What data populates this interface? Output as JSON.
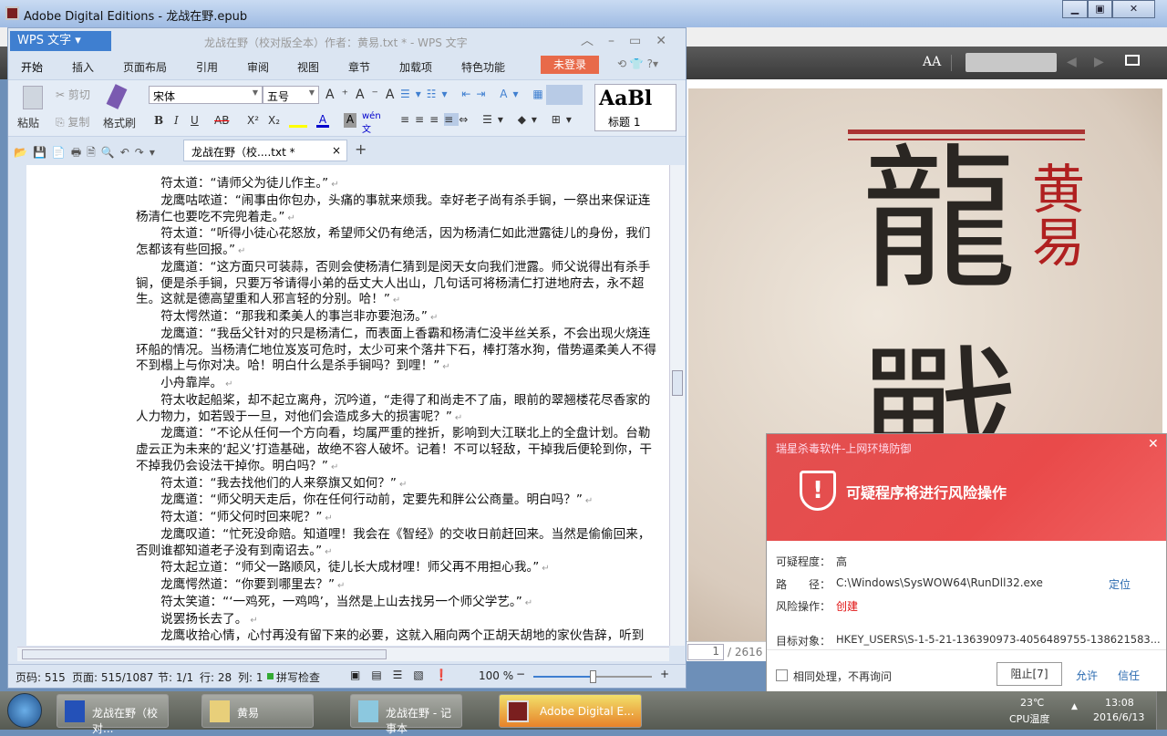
{
  "ade": {
    "title": "Adobe Digital Editions - 龙战在野.epub",
    "min": "▭",
    "max": "◻",
    "close": "✕",
    "font_size_label": "AA",
    "page_current": "1",
    "page_total": "/ 2616",
    "cover": {
      "big1": "龍",
      "big2": "戰",
      "author": "黄易"
    }
  },
  "wps": {
    "app_button": "WPS 文字",
    "title": "龙战在野（校对版全本）作者：黄易.txt * - WPS 文字",
    "tabs": [
      "开始",
      "插入",
      "页面布局",
      "引用",
      "审阅",
      "视图",
      "章节",
      "加载项",
      "特色功能"
    ],
    "login": "未登录",
    "ribbon": {
      "paste": "粘贴",
      "cut": "剪切",
      "copy": "复制",
      "format_painter": "格式刷",
      "font": "宋体",
      "size": "五号",
      "bold": "B",
      "italic": "I",
      "underline": "U",
      "strike": "AB",
      "sup": "X²",
      "sub": "X₂",
      "style_preview": "AaBl",
      "style_name": "标题 1",
      "style_name2": "标"
    },
    "doc_tab": "龙战在野（校....txt *",
    "doc_tab_close": "×",
    "new_tab": "+",
    "paragraphs": [
      "符太道：“请师父为徒儿作主。”",
      "龙鹰咕哝道：“闹事由你包办，头痛的事就来烦我。幸好老子尚有杀手锏，一祭出来保证连杨清仁也要吃不完兜着走。”",
      "符太道：“听得小徒心花怒放，希望师父仍有绝活，因为杨清仁如此泄露徒儿的身份，我们怎都该有些回报。”",
      "龙鹰道：“这方面只可装蒜，否则会使杨清仁猜到是闵天女向我们泄露。师父说得出有杀手锏，便是杀手锏，只要万爷请得小弟的岳丈大人出山，几句话可将杨清仁打进地府去，永不超生。这就是德高望重和人邪言轻的分别。哈！”",
      "符太愕然道：“那我和柔美人的事岂非亦要泡汤。”",
      "龙鹰道：“我岳父针对的只是杨清仁，而表面上香霸和杨清仁没半丝关系，不会出现火烧连环船的情况。当杨清仁地位岌岌可危时，太少可来个落井下石，棒打落水狗，借势逼柔美人不得不到榻上与你对决。哈！明白什么是杀手锏吗？到哩！”",
      "小舟靠岸。",
      "符太收起船桨，却不起立离舟，沉吟道，“走得了和尚走不了庙，眼前的翠翘楼花尽香家的人力物力，如若毁于一旦，对他们会造成多大的损害呢？”",
      "龙鹰道：“不论从任何一个方向看，均属严重的挫折，影响到大江联北上的全盘计划。台勒虚云正为未来的‘起义’打造基础，故绝不容人破坏。记着！不可以轻敌，干掉我后便轮到你，干不掉我仍会设法干掉你。明白吗？”",
      "符太道：“我去找他们的人来祭旗又如何？”",
      "龙鹰道：“师父明天走后，你在任何行动前，定要先和胖公公商量。明白吗？”",
      "符太道：“师父何时回来呢？”",
      "龙鹰叹道：“忙死没命赔。知道哩！我会在《智经》的交收日前赶回来。当然是偷偷回来，否则谁都知道老子没有到南诏去。”",
      "符太起立道：“师父一路顺风，徒儿长大成材哩！师父再不用担心我。”",
      "龙鹰愕然道：“你要到哪里去？”",
      "符太笑道：“‘一鸡死，一鸡鸣’，当然是上山去找另一个师父学艺。”",
      "说罢扬长去了。",
      "龙鹰收拾心情，心忖再没有留下来的必要，这就入厢向两个正胡天胡地的家伙告辞，听到"
    ],
    "status": {
      "page_no": "页码: 515",
      "page": "页面: 515/1087",
      "section": "节: 1/1",
      "row": "行: 28",
      "col": "列: 1",
      "spell": "拼写检查",
      "zoom": "100 %",
      "zoom_level": 0.5
    }
  },
  "popup": {
    "title": "瑞星杀毒软件-上网环境防御",
    "headline": "可疑程序将进行风险操作",
    "close": "✕",
    "rows": [
      {
        "label": "可疑程度：",
        "value": "高"
      },
      {
        "label": "路　　径：",
        "value": "C:\\Windows\\SysWOW64\\RunDll32.exe",
        "link": "定位"
      },
      {
        "label": "风险操作：",
        "value": "创建"
      },
      {
        "label": "目标对象：",
        "value": "HKEY_USERS\\S-1-5-21-136390973-4056489755-138621583..."
      }
    ],
    "checkbox": "相同处理，不再询问",
    "block": "阻止[7]",
    "allow": "允许",
    "trust": "信任"
  },
  "taskbar": {
    "items": [
      "龙战在野（校对...",
      "黄易",
      "龙战在野 - 记事本",
      "Adobe Digital E..."
    ],
    "temp": "23℃",
    "temp_label": "CPU温度",
    "time": "13:08",
    "date": "2016/6/13"
  },
  "colors": {
    "accent": "#4a86c8",
    "alert": "#e94a4a",
    "login": "#e86a4a"
  }
}
